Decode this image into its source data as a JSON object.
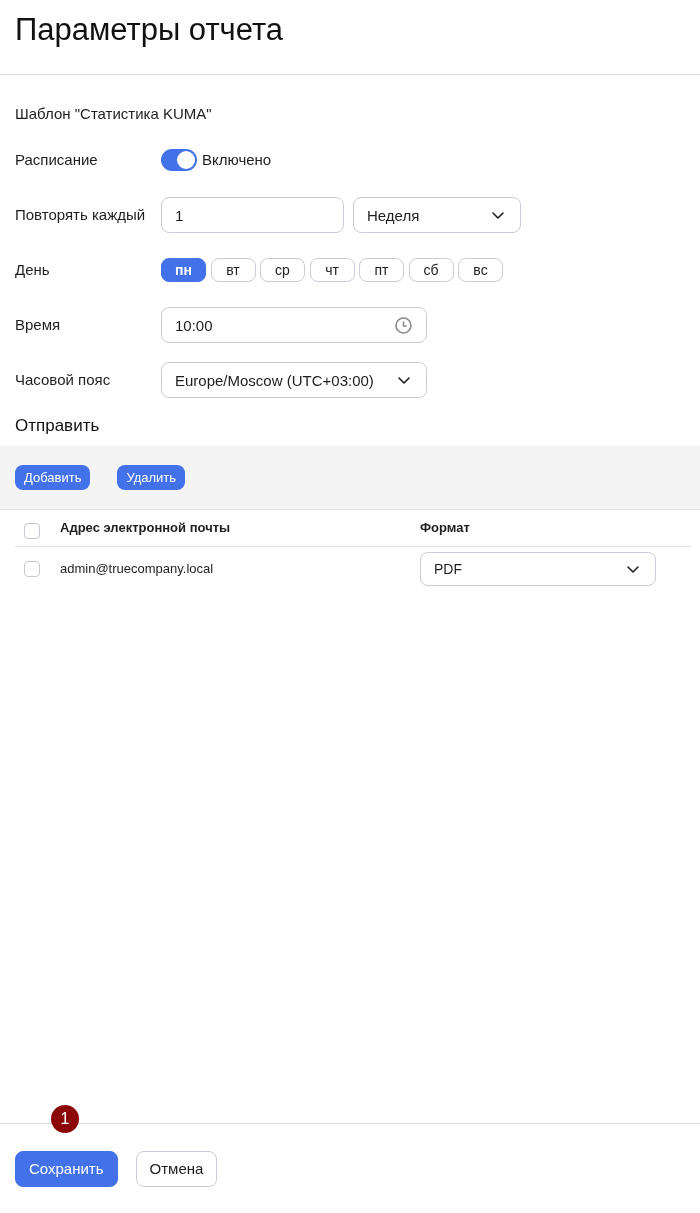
{
  "header": {
    "title": "Параметры отчета"
  },
  "template": "Шаблон \"Статистика KUMA\"",
  "schedule": {
    "label": "Расписание",
    "on": true,
    "state_text": "Включено"
  },
  "repeat": {
    "label": "Повторять каждый",
    "value": "1",
    "unit": "Неделя"
  },
  "day": {
    "label": "День",
    "days": [
      {
        "label": "пн",
        "selected": true
      },
      {
        "label": "вт",
        "selected": false
      },
      {
        "label": "ср",
        "selected": false
      },
      {
        "label": "чт",
        "selected": false
      },
      {
        "label": "пт",
        "selected": false
      },
      {
        "label": "сб",
        "selected": false
      },
      {
        "label": "вс",
        "selected": false
      }
    ]
  },
  "time": {
    "label": "Время",
    "value": "10:00"
  },
  "timezone": {
    "label": "Часовой пояс",
    "value": "Europe/Moscow (UTC+03:00)"
  },
  "send": {
    "title": "Отправить",
    "toolbar": [
      "Добавить",
      "Удалить"
    ],
    "table": {
      "columns": [
        "Адрес электронной почты",
        "Формат"
      ],
      "all_checked": false,
      "rows": [
        {
          "checked": false,
          "email": "admin@truecompany.local",
          "format": "PDF"
        }
      ]
    }
  },
  "footer": {
    "callout": "1",
    "buttons": [
      {
        "label": "Сохранить",
        "kind": "primary"
      },
      {
        "label": "Отмена",
        "kind": "secondary"
      }
    ]
  }
}
